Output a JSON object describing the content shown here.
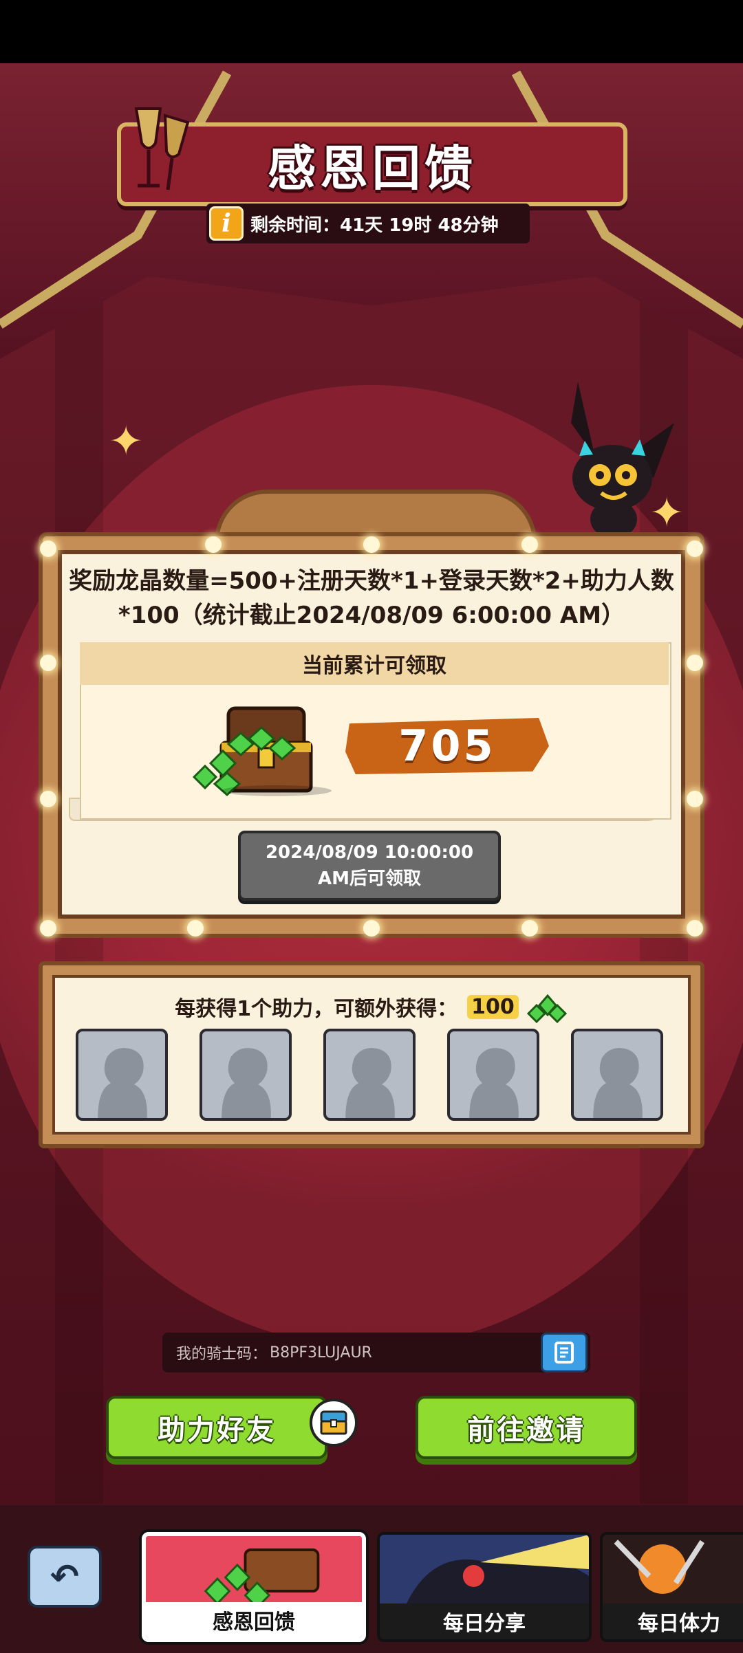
{
  "event": {
    "title": "感恩回馈",
    "time_label": "剩余时间：41天 19时 48分钟"
  },
  "reward": {
    "formula": "奖励龙晶数量=500+注册天数*1+登录天数*2+助力人数*100（统计截止2024/08/09 6:00:00 AM）",
    "panel_title": "当前累计可领取",
    "amount": "705",
    "claim_time": "2024/08/09 10:00:00 AM后可领取"
  },
  "helpers": {
    "text": "每获得1个助力，可额外获得：",
    "bonus": "100",
    "slots": [
      "",
      "",
      "",
      "",
      ""
    ]
  },
  "knight_code": {
    "label": "我的骑士码：",
    "value": "B8PF3LUJAUR"
  },
  "buttons": {
    "help_friend": "助力好友",
    "invite": "前往邀请"
  },
  "tabs": [
    {
      "label": "感恩回馈",
      "active": true
    },
    {
      "label": "每日分享",
      "active": false
    },
    {
      "label": "每日体力",
      "active": false
    }
  ],
  "colors": {
    "accent_gold": "#d7b563",
    "button_green": "#8fdb2f",
    "value_orange": "#c96416",
    "background_red": "#9a2434"
  },
  "icons": [
    "info-icon",
    "copy-icon",
    "back-arrow-icon",
    "treasure-chest-icon",
    "crystal-icon",
    "champagne-glasses-icon"
  ]
}
